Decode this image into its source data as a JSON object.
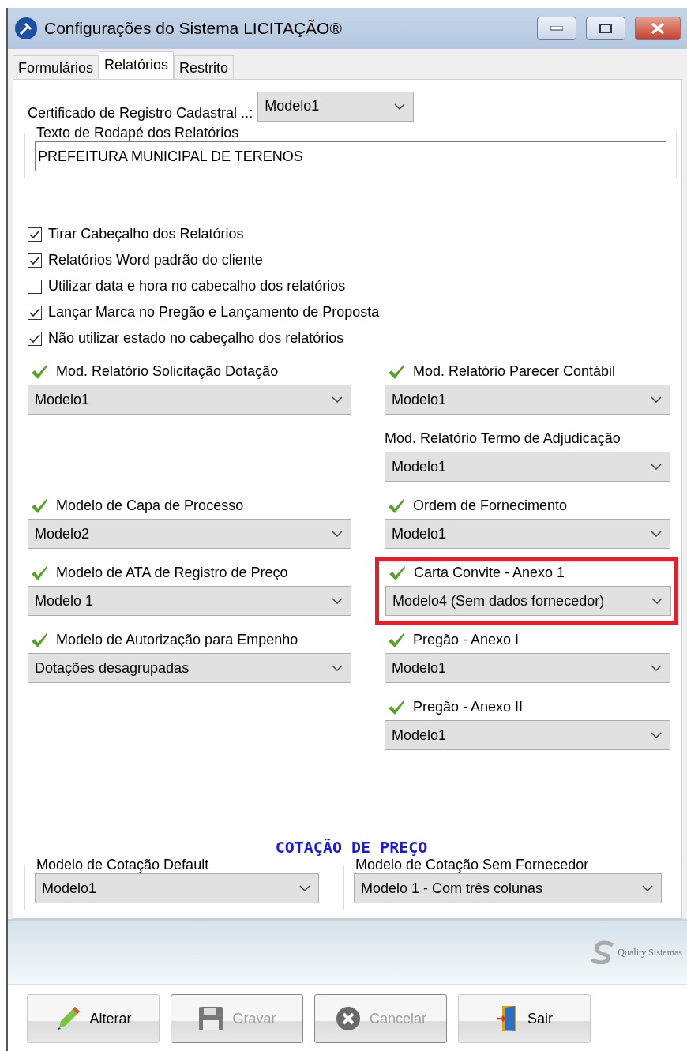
{
  "window": {
    "title": "Configurações do Sistema LICITAÇÃO®"
  },
  "tabs": [
    {
      "label": "Formulários",
      "selected": false
    },
    {
      "label": "Relatórios",
      "selected": true
    },
    {
      "label": "Restrito",
      "selected": false
    }
  ],
  "certificate": {
    "label": "Certificado de Registro Cadastral ..:",
    "value": "Modelo1"
  },
  "footer_text": {
    "legend": "Texto de  Rodapé dos Relatórios",
    "value": "PREFEITURA MUNICIPAL DE TERENOS"
  },
  "options": [
    {
      "label": "Tirar Cabeçalho dos Relatórios",
      "checked": true
    },
    {
      "label": "Relatórios Word padrão do cliente",
      "checked": true
    },
    {
      "label": "Utilizar data e hora no cabecalho dos relatórios",
      "checked": false
    },
    {
      "label": "Lançar Marca no Pregão e Lançamento de Proposta",
      "checked": true
    },
    {
      "label": "Não utilizar estado no cabeçalho dos relatórios",
      "checked": true
    }
  ],
  "model_rows": [
    {
      "left": {
        "label": "Mod. Relatório Solicitação Dotação",
        "value": "Modelo1",
        "check_icon": true,
        "highlighted": false
      },
      "right": {
        "label": "Mod. Relatório Parecer Contábil",
        "value": "Modelo1",
        "check_icon": true,
        "highlighted": false
      }
    },
    {
      "right": {
        "label": "Mod. Relatório Termo de Adjudicação",
        "value": "Modelo1",
        "check_icon": false,
        "highlighted": false
      }
    },
    {
      "left": {
        "label": "Modelo de Capa de Processo",
        "value": "Modelo2",
        "check_icon": true,
        "highlighted": false
      },
      "right": {
        "label": "Ordem de Fornecimento",
        "value": "Modelo1",
        "check_icon": true,
        "highlighted": false
      }
    },
    {
      "left": {
        "label": "Modelo de ATA de Registro de Preço",
        "value": "Modelo 1",
        "check_icon": true,
        "highlighted": false
      },
      "right": {
        "label": "Carta Convite - Anexo 1",
        "value": "Modelo4 (Sem dados fornecedor)",
        "check_icon": true,
        "highlighted": true
      }
    },
    {
      "left": {
        "label": "Modelo de Autorização para Empenho",
        "value": "Dotações desagrupadas",
        "check_icon": true,
        "highlighted": false
      },
      "right": {
        "label": "Pregão - Anexo I",
        "value": "Modelo1",
        "check_icon": true,
        "highlighted": false
      }
    },
    {
      "right": {
        "label": "Pregão - Anexo II",
        "value": "Modelo1",
        "check_icon": true,
        "highlighted": false
      }
    }
  ],
  "quotation": {
    "heading": "COTAÇÃO DE PREÇO",
    "groups": [
      {
        "legend": "Modelo de Cotação Default",
        "value": "Modelo1"
      },
      {
        "legend": "Modelo de Cotação Sem Fornecedor",
        "value": "Modelo 1 - Com três colunas"
      }
    ]
  },
  "brand": {
    "name": "Quality Sistemas"
  },
  "buttons": [
    {
      "label": "Alterar",
      "kind": "edit",
      "disabled": false
    },
    {
      "label": "Gravar",
      "kind": "save",
      "disabled": true
    },
    {
      "label": "Cancelar",
      "kind": "cancel",
      "disabled": true
    },
    {
      "label": "Sair",
      "kind": "exit",
      "disabled": false
    }
  ]
}
